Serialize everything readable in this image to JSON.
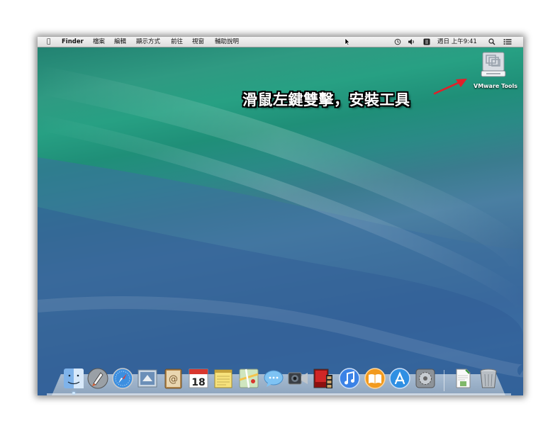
{
  "menubar": {
    "finder": "Finder",
    "items": [
      "檔案",
      "編輯",
      "顯示方式",
      "前往",
      "視窗",
      "輔助說明"
    ],
    "clock": "週日 上午9:41"
  },
  "desktop": {
    "vmware_label": "VMware Tools",
    "annotation": "滑鼠左鍵雙擊，安裝工具"
  },
  "dock": {
    "calendar_day": "18",
    "items": [
      "finder-icon",
      "launchpad-icon",
      "safari-icon",
      "mail-icon",
      "contacts-icon",
      "calendar-icon",
      "notes-icon",
      "maps-icon",
      "messages-icon",
      "facetime-icon",
      "photo-booth-icon",
      "itunes-icon",
      "ibooks-icon",
      "app-store-icon",
      "system-preferences-icon",
      "preview-document-icon",
      "trash-icon"
    ]
  },
  "colors": {
    "annotation_text": "#ffffff",
    "arrow": "#e0202a",
    "wave_top": "#2f9a82",
    "wave_bottom": "#35609a"
  }
}
